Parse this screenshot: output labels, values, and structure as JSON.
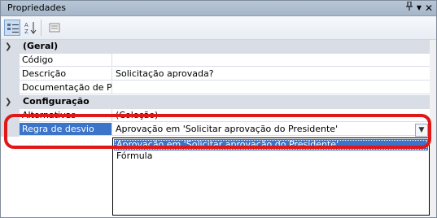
{
  "window": {
    "title": "Propriedades",
    "pin_icon": "pin-icon",
    "dropdown_icon": "dropdown-arrow-icon",
    "close_icon": "close-icon"
  },
  "toolbar": {
    "buttons": [
      {
        "name": "categorized-view-icon",
        "active": true
      },
      {
        "name": "alphabetical-sort-icon",
        "active": false
      },
      {
        "name": "property-pages-icon",
        "active": false
      }
    ]
  },
  "grid": {
    "categories": [
      {
        "label": "(Geral)"
      },
      {
        "label": "Configuração"
      }
    ],
    "general_rows": [
      {
        "name": "Código",
        "value": ""
      },
      {
        "name": "Descrição",
        "value": "Solicitação aprovada?"
      },
      {
        "name": "Documentação de Proc",
        "value": ""
      }
    ],
    "config_rows": [
      {
        "name": "Alternativas",
        "value": "(Coleção)"
      },
      {
        "name": "Regra de desvio",
        "value": "Aprovação em 'Solicitar aprovação do Presidente'"
      }
    ]
  },
  "dropdown": {
    "options": [
      "Aprovação em 'Solicitar aprovação do Presidente'",
      "Fórmula"
    ],
    "selected_index": 0
  },
  "colors": {
    "selection": "#3b74c9",
    "annotation": "#e01818",
    "category_bg": "#d8dde6"
  }
}
